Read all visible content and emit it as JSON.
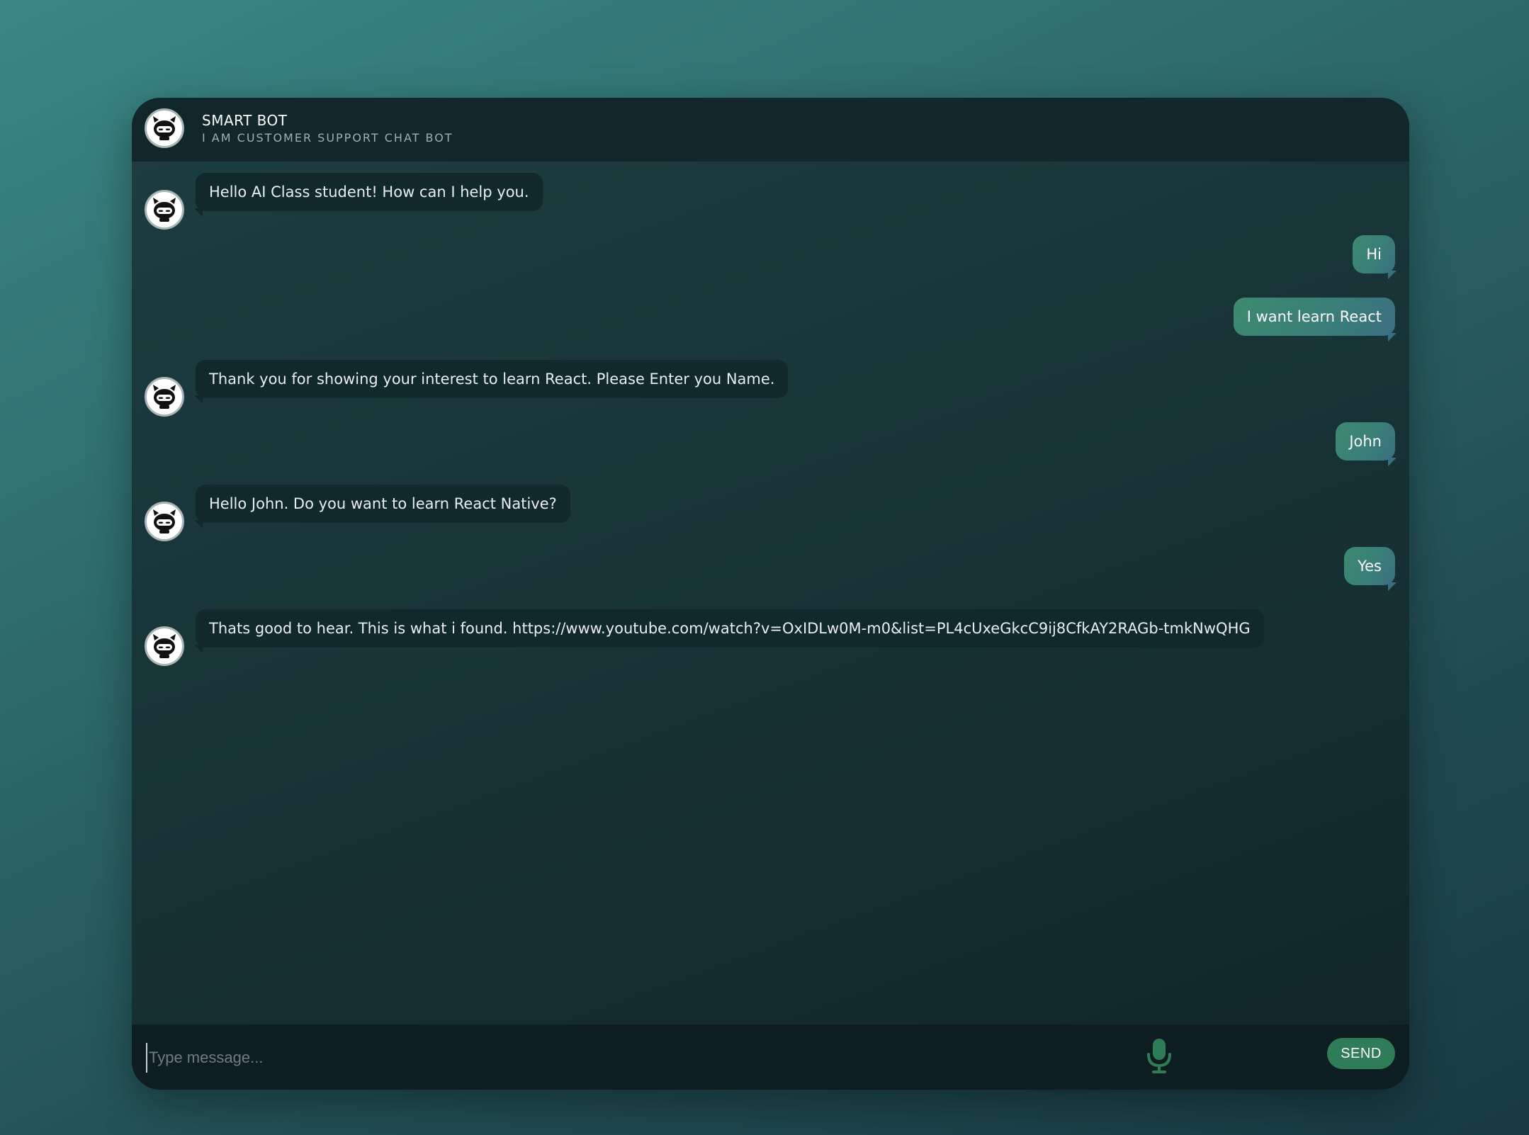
{
  "header": {
    "title": "SMART BOT",
    "subtitle": "I AM CUSTOMER SUPPORT CHAT BOT",
    "avatar_icon": "robot-icon"
  },
  "messages": [
    {
      "sender": "bot",
      "text": "Hello AI Class student! How can I help you."
    },
    {
      "sender": "user",
      "text": "Hi"
    },
    {
      "sender": "user",
      "text": "I want learn React"
    },
    {
      "sender": "bot",
      "text": "Thank you for showing your interest to learn React. Please Enter you Name."
    },
    {
      "sender": "user",
      "text": "John"
    },
    {
      "sender": "bot",
      "text": "Hello John. Do you want to learn React Native?"
    },
    {
      "sender": "user",
      "text": "Yes"
    },
    {
      "sender": "bot",
      "text": "Thats good to hear. This is what i found. https://www.youtube.com/watch?v=OxIDLw0M-m0&list=PL4cUxeGkcC9ij8CfkAY2RAGb-tmkNwQHG"
    }
  ],
  "composer": {
    "placeholder": "Type message...",
    "value": "",
    "mic_icon": "microphone-icon",
    "send_label": "SEND"
  },
  "colors": {
    "accent": "#2f7d57",
    "bot_bubble": "#12292c",
    "user_bubble_start": "#3d8a6e",
    "user_bubble_end": "#3b6f80",
    "header_bg": "#12272a",
    "input_bar_bg": "#0e1d1f"
  }
}
